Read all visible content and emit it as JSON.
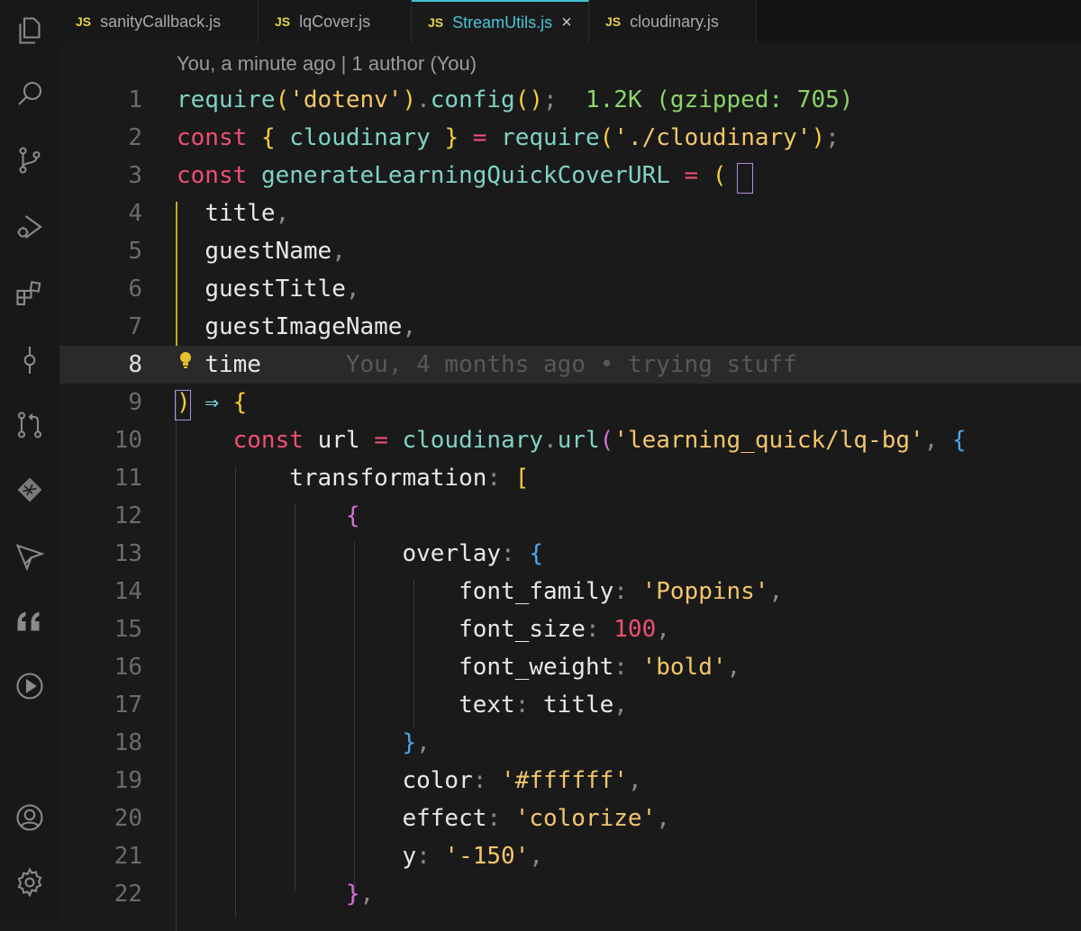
{
  "tabs": [
    {
      "icon": "JS",
      "label": "sanityCallback.js",
      "active": false
    },
    {
      "icon": "JS",
      "label": "lqCover.js",
      "active": false
    },
    {
      "icon": "JS",
      "label": "StreamUtils.js",
      "active": true,
      "close": "×"
    },
    {
      "icon": "JS",
      "label": "cloudinary.js",
      "active": false
    }
  ],
  "activity_icons": [
    "explorer-icon",
    "search-icon",
    "source-control-icon",
    "run-debug-icon",
    "extensions-icon",
    "git-commit-icon",
    "pull-request-icon",
    "netlify-icon",
    "deploy-icon",
    "quote-icon",
    "play-icon",
    "account-icon",
    "settings-icon"
  ],
  "editor": {
    "codelens": "You, a minute ago | 1 author (You)",
    "line_numbers": [
      "1",
      "2",
      "3",
      "4",
      "5",
      "6",
      "7",
      "8",
      "9",
      "10",
      "11",
      "12",
      "13",
      "14",
      "15",
      "16",
      "17",
      "18",
      "19",
      "20",
      "21",
      "22"
    ],
    "import_size": "1.2K (gzipped: 705)",
    "inline_blame": "You, 4 months ago • trying stuff",
    "tokens": {
      "require": "require",
      "dotenv": "'dotenv'",
      "config": "config",
      "const": "const",
      "cloudinary": "cloudinary",
      "cloudinary_path": "'./cloudinary'",
      "generate_fn": "generateLearningQuickCoverURL",
      "title": "title",
      "guestName": "guestName",
      "guestTitle": "guestTitle",
      "guestImageName": "guestImageName",
      "time": "time",
      "url": "url",
      "url_fn": "url",
      "bg_path": "'learning_quick/lq-bg'",
      "transformation": "transformation",
      "overlay": "overlay",
      "font_family": "font_family",
      "poppins": "'Poppins'",
      "font_size": "font_size",
      "size_value": "100",
      "font_weight": "font_weight",
      "bold": "'bold'",
      "text": "text",
      "title_ref": "title",
      "color": "color",
      "color_value": "'#ffffff'",
      "effect": "effect",
      "colorize": "'colorize'",
      "y": "y",
      "y_value": "'-150'"
    }
  }
}
